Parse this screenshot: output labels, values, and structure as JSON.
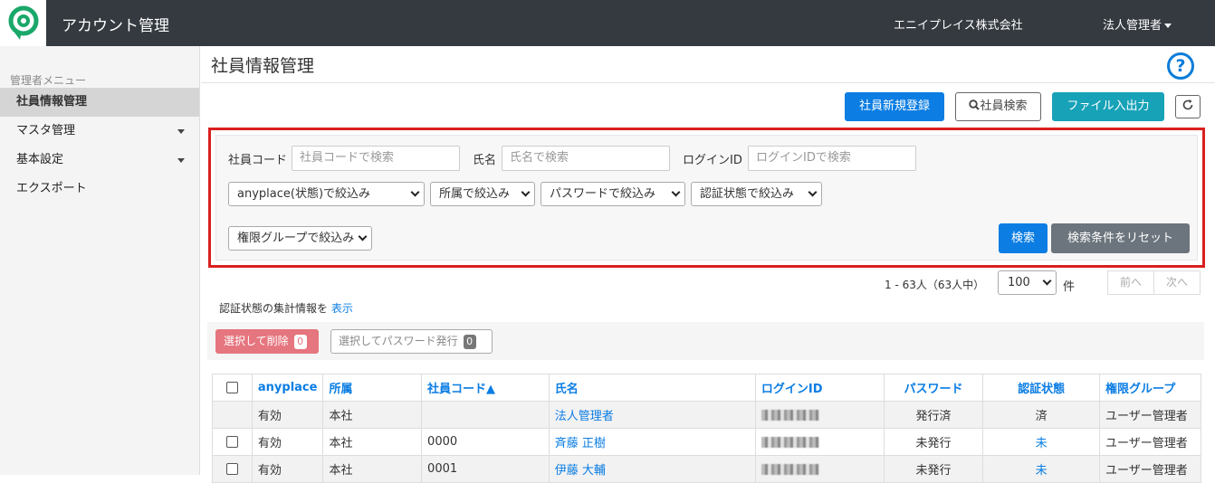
{
  "header": {
    "app_title": "アカウント管理",
    "company": "エニイプレイス株式会社",
    "user_menu": "法人管理者"
  },
  "sidebar": {
    "heading": "管理者メニュー",
    "items": [
      {
        "label": "社員情報管理",
        "active": true
      },
      {
        "label": "マスタ管理",
        "has_submenu": true
      },
      {
        "label": "基本設定",
        "has_submenu": true
      },
      {
        "label": "エクスポート"
      }
    ]
  },
  "page": {
    "title": "社員情報管理",
    "help_icon": "?"
  },
  "toolbar": {
    "new_employee": "社員新規登録",
    "search": "社員検索",
    "file_io": "ファイル入出力",
    "refresh_icon": "refresh-icon"
  },
  "search_form": {
    "code_label": "社員コード",
    "code_placeholder": "社員コードで検索",
    "name_label": "氏名",
    "name_placeholder": "氏名で検索",
    "login_label": "ログインID",
    "login_placeholder": "ログインIDで検索",
    "filters": [
      "anyplace(状態)で絞込み",
      "所属で絞込み",
      "パスワードで絞込み",
      "認証状態で絞込み",
      "権限グループで絞込み"
    ],
    "search_button": "検索",
    "reset_button": "検索条件をリセット"
  },
  "pagination": {
    "summary": "1 - 63人（63人中）",
    "per_page": "100",
    "unit": "件",
    "prev": "前へ",
    "next": "次へ"
  },
  "stats": {
    "text": "認証状態の集計情報を",
    "link": "表示"
  },
  "bulk_actions": {
    "delete_label": "選択して削除",
    "delete_count": "0",
    "password_label": "選択してパスワード発行",
    "password_count": "0"
  },
  "table": {
    "columns": [
      "anyplace",
      "所属",
      "社員コード▲",
      "氏名",
      "ログインID",
      "パスワード",
      "認証状態",
      "権限グループ"
    ],
    "rows": [
      {
        "anyplace": "有効",
        "dept": "本社",
        "code": "",
        "name": "法人管理者",
        "password": "発行済",
        "auth": "済",
        "group": "ユーザー管理者",
        "checkbox": false
      },
      {
        "anyplace": "有効",
        "dept": "本社",
        "code": "0000",
        "name": "斉藤 正樹",
        "password": "未発行",
        "auth": "未",
        "group": "ユーザー管理者",
        "checkbox": true
      },
      {
        "anyplace": "有効",
        "dept": "本社",
        "code": "0001",
        "name": "伊藤 大輔",
        "password": "未発行",
        "auth": "未",
        "group": "ユーザー管理者",
        "checkbox": true
      }
    ]
  }
}
